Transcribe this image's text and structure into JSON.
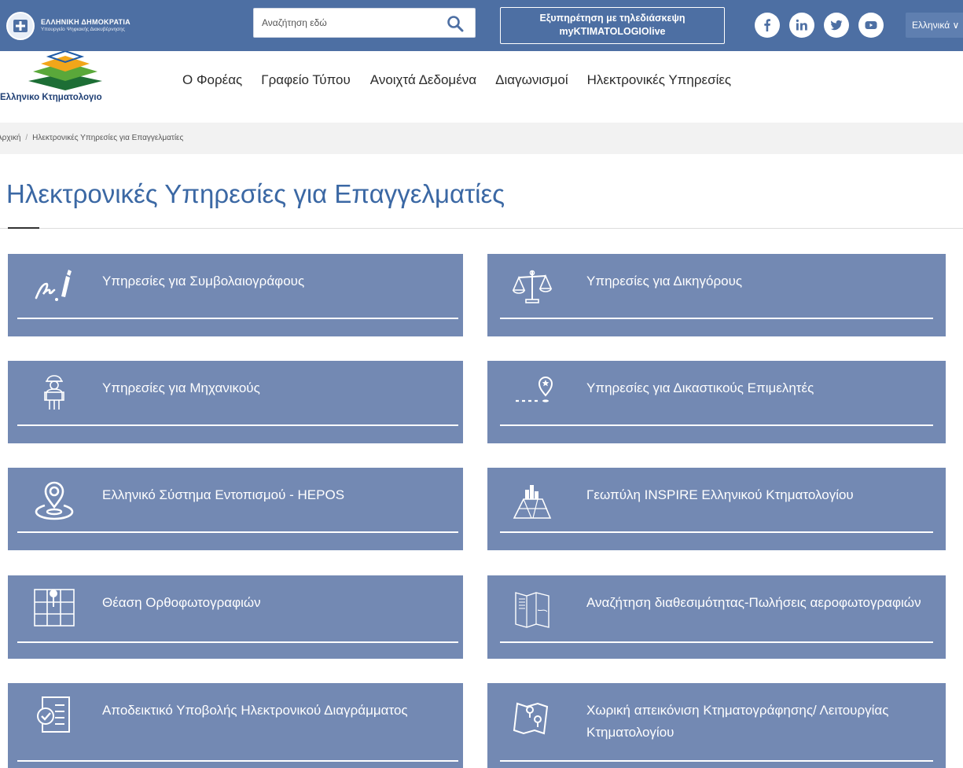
{
  "topbar": {
    "gov_title": "ΕΛΛΗΝΙΚΗ ΔΗΜΟΚΡΑΤΙΑ",
    "gov_subtitle": "Υπουργείο Ψηφιακής Διακυβέρνησης",
    "search_placeholder": "Αναζήτηση εδώ",
    "live_line1": "Εξυπηρέτηση με τηλεδιάσκεψη",
    "live_line2": "myKTIMATOLOGIOlive",
    "language": "Ελληνικά ∨",
    "social_icons": [
      "facebook-icon",
      "linkedin-icon",
      "twitter-icon",
      "youtube-icon"
    ]
  },
  "header": {
    "logo_text": "Ελληνικο Κτηματολογιο",
    "nav": [
      "Ο Φορέας",
      "Γραφείο Τύπου",
      "Ανοιχτά Δεδομένα",
      "Διαγωνισμοί",
      "Ηλεκτρονικές Υπηρεσίες"
    ]
  },
  "breadcrumb": {
    "home": "Αρχική",
    "separator": "/",
    "current": "Ηλεκτρονικές Υπηρεσίες για Επαγγελματίες"
  },
  "page": {
    "title": "Ηλεκτρονικές Υπηρεσίες για Επαγγελματίες"
  },
  "cards": [
    {
      "label": "Υπηρεσίες για Συμβολαιογράφους",
      "icon": "signature-pen-icon"
    },
    {
      "label": "Υπηρεσίες για Δικηγόρους",
      "icon": "scales-icon"
    },
    {
      "label": "Υπηρεσίες για Μηχανικούς",
      "icon": "engineer-icon"
    },
    {
      "label": "Υπηρεσίες για Δικαστικούς Επιμελητές",
      "icon": "location-pin-path-icon"
    },
    {
      "label": "Ελληνικό Σύστημα Εντοπισμού - HEPOS",
      "icon": "location-pin-icon"
    },
    {
      "label": "Γεωπύλη INSPIRE Ελληνικού Κτηματολογίου",
      "icon": "city-map-icon"
    },
    {
      "label": "Θέαση Ορθοφωτογραφιών",
      "icon": "grid-map-pin-icon"
    },
    {
      "label": "Αναζήτηση διαθεσιμότητας-Πωλήσεις αεροφωτογραφιών",
      "icon": "folded-map-icon"
    },
    {
      "label": "Αποδεικτικό Υποβολής Ηλεκτρονικού Διαγράμματος",
      "icon": "checklist-document-icon"
    },
    {
      "label": "Χωρική απεικόνιση Κτηματογράφησης/ Λειτουργίας Κτηματολογίου",
      "icon": "map-pins-icon"
    }
  ],
  "colors": {
    "topbar": "#4d6fa3",
    "card": "#7389b3",
    "title": "#3b68a4"
  }
}
